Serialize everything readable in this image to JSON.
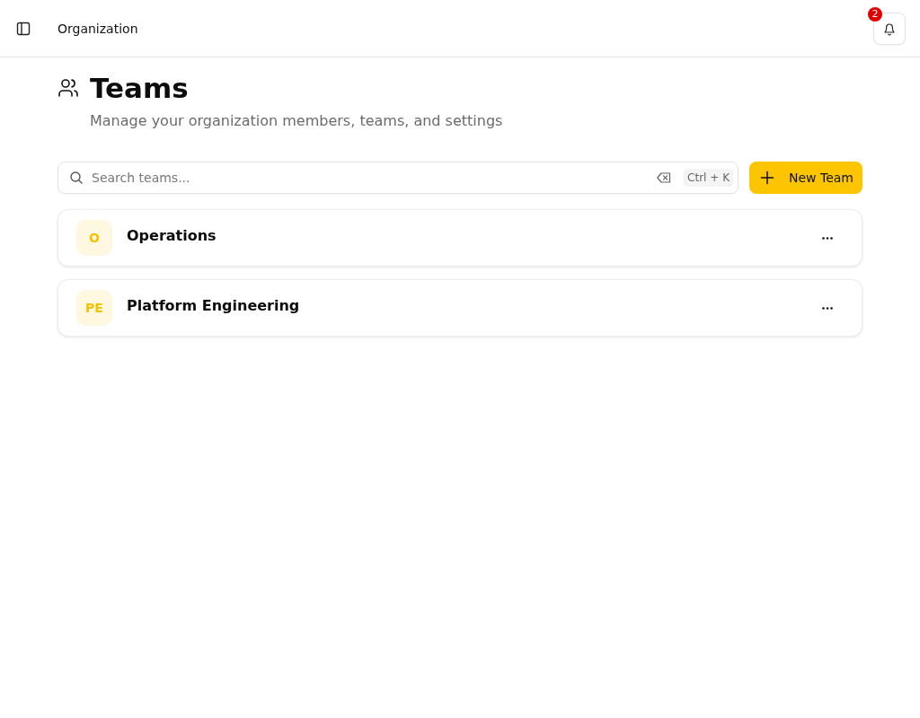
{
  "header": {
    "title": "Organization",
    "notifications": {
      "count": "2"
    }
  },
  "page": {
    "title": "Teams",
    "subtitle": "Manage your organization members, teams, and settings"
  },
  "toolbar": {
    "search": {
      "placeholder": "Search teams...",
      "shortcut": "Ctrl + K"
    },
    "new_button": {
      "label": "New Team"
    }
  },
  "teams": [
    {
      "initials": "O",
      "name": "Operations"
    },
    {
      "initials": "PE",
      "name": "Platform Engineering"
    }
  ]
}
